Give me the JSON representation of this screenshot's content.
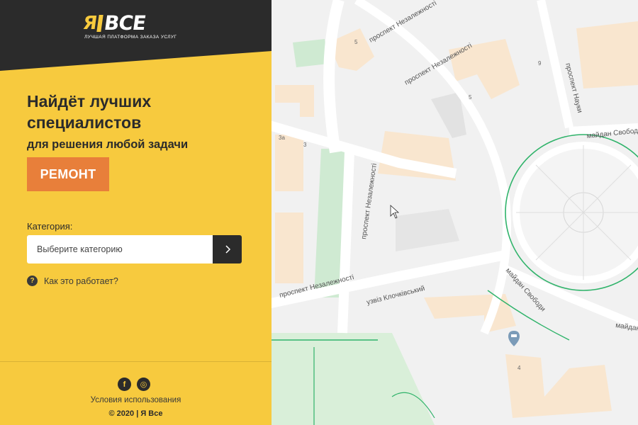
{
  "brand": {
    "logo_ya": "Я",
    "logo_vse": "ВСЕ",
    "tagline": "ЛУЧШАЯ ПЛАТФОРМА ЗАКАЗА УСЛУГ",
    "colors": {
      "primary": "#f7ca3e",
      "dark": "#2b2b2b",
      "accent": "#e87f3a"
    }
  },
  "hero": {
    "headline": "Найдёт лучших специалистов",
    "subline": "для решения любой задачи",
    "rotating_word": "РЕМОНТ"
  },
  "search": {
    "category_label": "Категория:",
    "category_placeholder": "Выберите категорию",
    "submit_icon": "chevron-right-icon"
  },
  "help": {
    "icon": "question-icon",
    "label": "Как это работает?"
  },
  "footer": {
    "social": [
      {
        "name": "facebook-icon",
        "glyph": "f"
      },
      {
        "name": "instagram-icon",
        "glyph": "◎"
      }
    ],
    "terms": "Условия использования",
    "copyright": "© 2020 | Я Все"
  },
  "map": {
    "streets": {
      "nez_top": "проспект Незалежності",
      "nez_top2": "проспект Незалежності",
      "nez_vertical": "проспект Незалежності",
      "nez_left": "проспект Незалежності",
      "nauky": "проспект Науки",
      "svobody1": "майдан Свобод",
      "svobody2": "майдан Свободи",
      "svobody3": "майдан Свободи",
      "uzviz": "узвіз Клочківський"
    },
    "numbers": [
      "5",
      "9",
      "5",
      "3a",
      "3",
      "4"
    ]
  }
}
